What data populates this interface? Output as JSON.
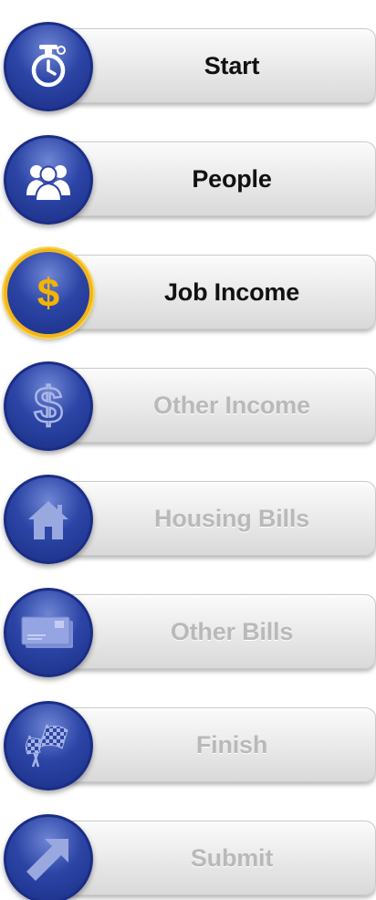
{
  "steps": [
    {
      "label": "Start",
      "icon": "stopwatch-icon",
      "state": "done"
    },
    {
      "label": "People",
      "icon": "people-icon",
      "state": "done"
    },
    {
      "label": "Job Income",
      "icon": "dollar-icon",
      "state": "current"
    },
    {
      "label": "Other Income",
      "icon": "outlined-dollar-icon",
      "state": "todo"
    },
    {
      "label": "Housing Bills",
      "icon": "house-icon",
      "state": "todo"
    },
    {
      "label": "Other Bills",
      "icon": "envelope-icon",
      "state": "todo"
    },
    {
      "label": "Finish",
      "icon": "checkered-flag-icon",
      "state": "todo"
    },
    {
      "label": "Submit",
      "icon": "arrow-icon",
      "state": "todo"
    }
  ],
  "colors": {
    "circle_blue": "#2c45a6",
    "current_ring": "#f2b61b",
    "dollar_gold": "#f5b400",
    "done_text": "#111111",
    "todo_text": "#b9b9b9"
  }
}
